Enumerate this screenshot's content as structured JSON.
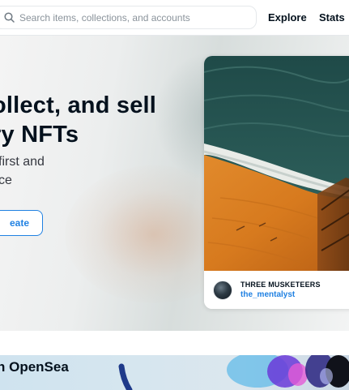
{
  "header": {
    "search_placeholder": "Search items, collections, and accounts",
    "nav": {
      "explore": "Explore",
      "stats": "Stats"
    }
  },
  "hero": {
    "title_line1": "ollect, and sell",
    "title_line2": "ry NFTs",
    "subtitle_line1": "first and",
    "subtitle_line2": "ce",
    "create_button": "eate"
  },
  "featured": {
    "collection_name": "THREE MUSKETEERS",
    "creator": "the_mentalyst"
  },
  "banner": {
    "title": "n OpenSea"
  },
  "colors": {
    "accent": "#2081e2",
    "text_primary": "#04111d",
    "text_secondary": "#353840",
    "border": "#e5e8eb"
  },
  "icons": {
    "search": "search-icon"
  }
}
